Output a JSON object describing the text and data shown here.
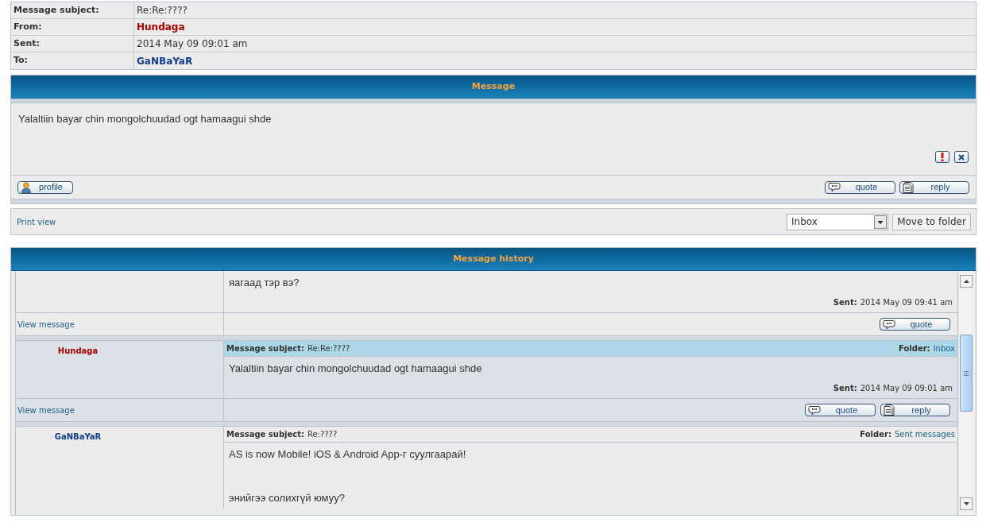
{
  "header_fields": [
    {
      "label": "Message subject:",
      "value": "Re:Re:????",
      "kind": "text"
    },
    {
      "label": "From:",
      "value": "Hundaga",
      "kind": "user",
      "color": "#aa0000"
    },
    {
      "label": "Sent:",
      "value": "2014 May 09 09:01 am",
      "kind": "text"
    },
    {
      "label": "To:",
      "value": "GaNBaYaR",
      "kind": "user",
      "color": "#103c8f"
    }
  ],
  "message": {
    "title": "Message",
    "body": "Yalaltiin bayar chin mongolchuudad ogt hamaagui shde",
    "left_buttons": [
      {
        "kind": "profile",
        "label": "profile"
      }
    ],
    "right_buttons": [
      {
        "kind": "quote",
        "label": "quote"
      },
      {
        "kind": "reply",
        "label": "reply"
      }
    ]
  },
  "folder_bar": {
    "print_link": "Print view",
    "folder_select": {
      "value": "Inbox"
    },
    "move_button": "Move to folder"
  },
  "history": {
    "title": "Message history",
    "entries": [
      {
        "selected": false,
        "body": [
          "яагаад тэр вэ?"
        ],
        "sent_label": "Sent:",
        "sent": "2014 May 09 09:41 am",
        "view_link": "View message",
        "buttons": [
          {
            "kind": "quote",
            "label": "quote"
          }
        ]
      },
      {
        "selected": true,
        "author": "Hundaga",
        "color": "#aa0000",
        "subject_label": "Message subject:",
        "subject": "Re:Re:????",
        "folder_label": "Folder:",
        "folder": "Inbox",
        "body": [
          "Yalaltiin bayar chin mongolchuudad ogt hamaagui shde"
        ],
        "sent_label": "Sent:",
        "sent": "2014 May 09 09:01 am",
        "view_link": "View message",
        "buttons": [
          {
            "kind": "quote",
            "label": "quote"
          },
          {
            "kind": "reply",
            "label": "reply"
          }
        ]
      },
      {
        "selected": false,
        "author": "GaNBaYaR",
        "color": "#103c8f",
        "subject_label": "Message subject:",
        "subject": "Re:????",
        "folder_label": "Folder:",
        "folder": "Sent messages",
        "body": [
          "AS is now Mobile! iOS & Android App-г суулгаарай!",
          "энийгээ солихгүй юмуу?"
        ]
      }
    ]
  }
}
